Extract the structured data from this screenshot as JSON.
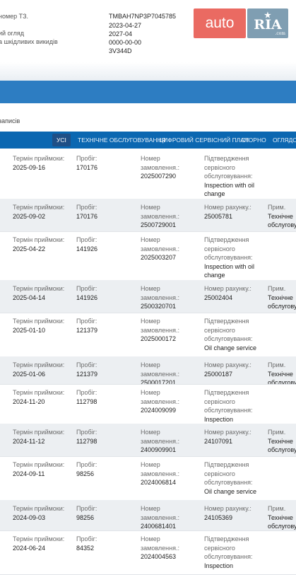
{
  "vehicle_info": {
    "labels": [
      "номер ТЗ.",
      "",
      "ий огляд",
      "а шкідливих викидів"
    ],
    "values": [
      "TMBAH7NP3P7045785",
      "2023-04-27",
      "2027-04",
      "0000-00-00",
      "3V344D"
    ]
  },
  "logo": {
    "auto": "auto",
    "ria": "RIA",
    "com": ".com",
    "star": "★"
  },
  "records_count": "записів",
  "tabs": [
    "УСІ",
    "ТЕХНІЧНЕ ОБСЛУГОВУВАННЯ",
    "ЦИФРОВИЙ СЕРВІСНИЙ ПЛАН",
    "СТОРНО",
    "ОГЛЯДОВ"
  ],
  "records": [
    {
      "date_label": "Термін приймоки:",
      "date": "2025-09-16",
      "km_label": "Пробіг:",
      "km": "170176",
      "c3": [
        "Номер",
        "замовлення.:",
        "2025007290"
      ],
      "c4": [
        "Підтвердження",
        "сервісного",
        "обслуговування:",
        "Inspection with oil",
        "change"
      ],
      "c5": []
    },
    {
      "date_label": "Термін приймоки:",
      "date": "2025-09-02",
      "km_label": "Пробіг:",
      "km": "170176",
      "c3": [
        "Номер",
        "замовлення.:",
        "2500729001"
      ],
      "c4": [
        "Номер рахунку.:",
        "25005781"
      ],
      "c5": [
        "Прим.",
        "Технічне",
        "обслугову"
      ]
    },
    {
      "date_label": "Термін приймоки:",
      "date": "2025-04-22",
      "km_label": "Пробіг:",
      "km": "141926",
      "c3": [
        "Номер",
        "замовлення.:",
        "2025003207"
      ],
      "c4": [
        "Підтвердження",
        "сервісного",
        "обслуговування:",
        "Inspection with oil",
        "change"
      ],
      "c5": []
    },
    {
      "date_label": "Термін приймоки:",
      "date": "2025-04-14",
      "km_label": "Пробіг:",
      "km": "141926",
      "c3": [
        "Номер",
        "замовлення.:",
        "2500320701"
      ],
      "c4": [
        "Номер рахунку.:",
        "25002404"
      ],
      "c5": [
        "Прим.",
        "Технічне",
        "обслугову"
      ]
    },
    {
      "date_label": "Термін приймоки:",
      "date": "2025-01-10",
      "km_label": "Пробіг:",
      "km": "121379",
      "c3": [
        "Номер",
        "замовлення.:",
        "2025000172"
      ],
      "c4": [
        "Підтвердження",
        "сервісного",
        "обслуговування:",
        "Oil change service"
      ],
      "c5": []
    },
    {
      "date_label": "Термін приймоки:",
      "date": "2025-01-06",
      "km_label": "Пробіг:",
      "km": "121379",
      "c3": [
        "Номер",
        "замовлення.:",
        "2500017201"
      ],
      "c4": [
        "Номер рахунку.:",
        "25000187"
      ],
      "c5": [
        "Прим.",
        "Технічне",
        "обслугову"
      ]
    },
    {
      "date_label": "Термін приймоки:",
      "date": "2024-11-20",
      "km_label": "Пробіг:",
      "km": "112798",
      "c3": [
        "Номер",
        "замовлення.:",
        "2024009099"
      ],
      "c4": [
        "Підтвердження",
        "сервісного",
        "обслуговування:",
        "Inspection"
      ],
      "c5": []
    },
    {
      "date_label": "Термін приймоки:",
      "date": "2024-11-12",
      "km_label": "Пробіг:",
      "km": "112798",
      "c3": [
        "Номер",
        "замовлення.:",
        "2400909901"
      ],
      "c4": [
        "Номер рахунку.:",
        "24107091"
      ],
      "c5": [
        "Прим.",
        "Технічне",
        "обслугову"
      ]
    },
    {
      "date_label": "Термін приймоки:",
      "date": "2024-09-11",
      "km_label": "Пробіг:",
      "km": "98256",
      "c3": [
        "Номер",
        "замовлення.:",
        "2024006814"
      ],
      "c4": [
        "Підтвердження",
        "сервісного",
        "обслуговування:",
        "Oil change service"
      ],
      "c5": []
    },
    {
      "date_label": "Термін приймоки:",
      "date": "2024-09-03",
      "km_label": "Пробіг:",
      "km": "98256",
      "c3": [
        "Номер",
        "замовлення.:",
        "2400681401"
      ],
      "c4": [
        "Номер рахунку.:",
        "24105369"
      ],
      "c5": [
        "Прим.",
        "Технічне",
        "обслугову"
      ]
    },
    {
      "date_label": "Термін приймоки:",
      "date": "2024-06-24",
      "km_label": "Пробіг:",
      "km": "84352",
      "c3": [
        "Номер",
        "замовлення.:",
        "2024004563"
      ],
      "c4": [
        "Підтвердження",
        "сервісного",
        "обслуговування:",
        "Inspection"
      ],
      "c5": []
    }
  ],
  "colors": {
    "band": "#2d7dc2",
    "tabbar": "#0b67b1",
    "active_tab": "#1f4f86",
    "row_alt": "#eceff2",
    "logo_auto": "#ea6a62",
    "logo_ria": "#7f9eb2"
  }
}
